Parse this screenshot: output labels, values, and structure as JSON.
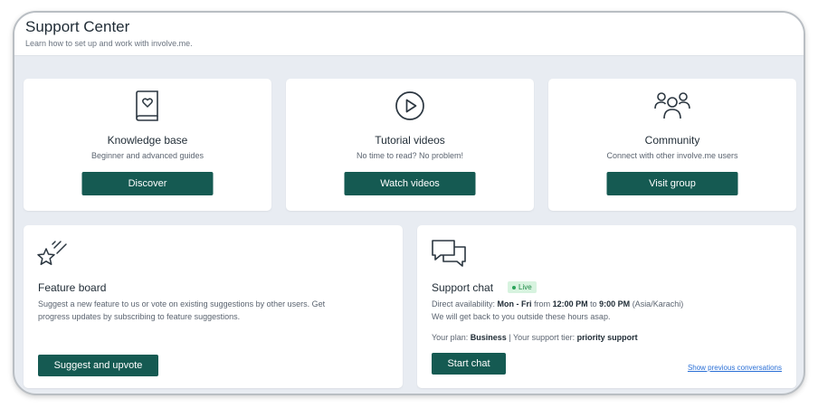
{
  "header": {
    "title": "Support Center",
    "subtitle": "Learn how to set up and work with involve.me."
  },
  "cards": {
    "knowledge": {
      "icon": "book-heart-icon",
      "title": "Knowledge base",
      "subtitle": "Beginner and advanced guides",
      "button": "Discover"
    },
    "tutorials": {
      "icon": "play-circle-icon",
      "title": "Tutorial videos",
      "subtitle": "No time to read? No problem!",
      "button": "Watch videos"
    },
    "community": {
      "icon": "users-group-icon",
      "title": "Community",
      "subtitle": "Connect with other involve.me users",
      "button": "Visit group"
    }
  },
  "feature_board": {
    "icon": "shooting-star-icon",
    "title": "Feature board",
    "description_line1": "Suggest a new feature to us or vote on existing suggestions by other users. Get",
    "description_line2": "progress updates by subscribing to feature suggestions.",
    "button": "Suggest and upvote"
  },
  "support_chat": {
    "icon": "chat-bubbles-icon",
    "title": "Support chat",
    "badge": "Live",
    "availability_label": "Direct availability:",
    "days": "Mon - Fri",
    "from_word": "from",
    "start_time": "12:00 PM",
    "to_word": "to",
    "end_time": "9:00 PM",
    "timezone": "(Asia/Karachi)",
    "outside_hours": "We will get back to you outside these hours asap.",
    "plan_label": "Your plan:",
    "plan_value": "Business",
    "tier_label": "| Your support tier:",
    "tier_value": "priority support",
    "button": "Start chat",
    "history_link": "Show previous conversations"
  },
  "colors": {
    "accent": "#155a52",
    "background": "#e8ecf2",
    "live_badge_bg": "#d7f3df",
    "live_badge_text": "#1f8a48",
    "link": "#2a6fd6"
  }
}
